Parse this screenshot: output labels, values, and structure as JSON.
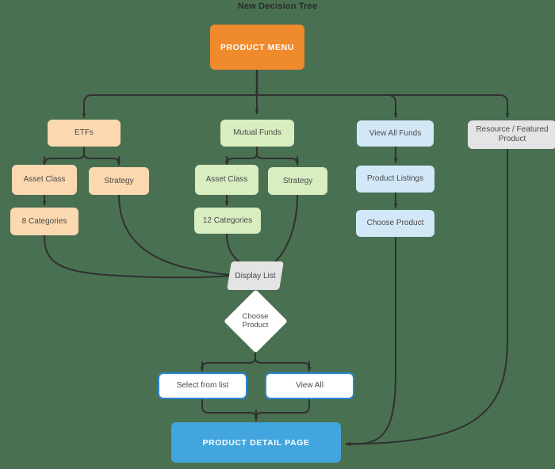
{
  "title": "New Decision Tree",
  "theme": {
    "background": "#4a7052",
    "edge_color": "#2f3130",
    "peach": "#fbd8af",
    "green": "#d8edc0",
    "blue_light": "#d2e8f7",
    "gray": "#e4e4e4",
    "orange": "#ef8b2c",
    "blue_solid": "#42a5dd",
    "blue_border": "#2b87cf",
    "white": "#ffffff",
    "text_dark": "#4a4a4a",
    "text_light": "#ffffff"
  },
  "nodes": {
    "product_menu": {
      "label": "PRODUCT MENU",
      "shape": "rect",
      "color": "orange"
    },
    "etfs": {
      "label": "ETFs",
      "shape": "rect",
      "color": "peach"
    },
    "etf_asset_class": {
      "label": "Asset Class",
      "shape": "rect",
      "color": "peach"
    },
    "etf_strategy": {
      "label": "Strategy",
      "shape": "rect",
      "color": "peach"
    },
    "etf_categories": {
      "label": "8 Categories",
      "shape": "rect",
      "color": "peach"
    },
    "mutual_funds": {
      "label": "Mutual Funds",
      "shape": "rect",
      "color": "green"
    },
    "mf_asset_class": {
      "label": "Asset Class",
      "shape": "rect",
      "color": "green"
    },
    "mf_strategy": {
      "label": "Strategy",
      "shape": "rect",
      "color": "green"
    },
    "mf_categories": {
      "label": "12 Categories",
      "shape": "rect",
      "color": "green"
    },
    "view_all_funds": {
      "label": "View All Funds",
      "shape": "rect",
      "color": "blue_light"
    },
    "product_listings": {
      "label": "Product Listings",
      "shape": "rect",
      "color": "blue_light"
    },
    "choose_product_right": {
      "label": "Choose Product",
      "shape": "rect",
      "color": "blue_light"
    },
    "resource_featured": {
      "label_line1": "Resource / Featured",
      "label_line2": "Product",
      "shape": "rect",
      "color": "gray"
    },
    "display_list": {
      "label": "Display List",
      "shape": "parallelogram",
      "color": "gray"
    },
    "choose_product_decision": {
      "label_line1": "Choose",
      "label_line2": "Product",
      "shape": "diamond",
      "color": "white"
    },
    "select_from_list": {
      "label": "Select from list",
      "shape": "rect",
      "color": "white_blue_border"
    },
    "view_all": {
      "label": "View All",
      "shape": "rect",
      "color": "white_blue_border"
    },
    "product_detail_page": {
      "label": "PRODUCT DETAIL PAGE",
      "shape": "rect",
      "color": "blue_solid"
    }
  },
  "edges": [
    {
      "from": "product_menu",
      "to": "etfs"
    },
    {
      "from": "product_menu",
      "to": "mutual_funds"
    },
    {
      "from": "product_menu",
      "to": "view_all_funds"
    },
    {
      "from": "product_menu",
      "to": "resource_featured"
    },
    {
      "from": "etfs",
      "to": "etf_asset_class"
    },
    {
      "from": "etfs",
      "to": "etf_strategy"
    },
    {
      "from": "etf_asset_class",
      "to": "etf_categories"
    },
    {
      "from": "etf_categories",
      "to": "display_list"
    },
    {
      "from": "etf_strategy",
      "to": "display_list"
    },
    {
      "from": "mutual_funds",
      "to": "mf_asset_class"
    },
    {
      "from": "mutual_funds",
      "to": "mf_strategy"
    },
    {
      "from": "mf_asset_class",
      "to": "mf_categories"
    },
    {
      "from": "mf_categories",
      "to": "display_list"
    },
    {
      "from": "mf_strategy",
      "to": "display_list"
    },
    {
      "from": "view_all_funds",
      "to": "product_listings"
    },
    {
      "from": "product_listings",
      "to": "choose_product_right"
    },
    {
      "from": "choose_product_right",
      "to": "product_detail_page"
    },
    {
      "from": "resource_featured",
      "to": "product_detail_page"
    },
    {
      "from": "display_list",
      "to": "choose_product_decision"
    },
    {
      "from": "choose_product_decision",
      "to": "select_from_list"
    },
    {
      "from": "choose_product_decision",
      "to": "view_all"
    },
    {
      "from": "select_from_list",
      "to": "product_detail_page"
    },
    {
      "from": "view_all",
      "to": "product_detail_page"
    }
  ]
}
